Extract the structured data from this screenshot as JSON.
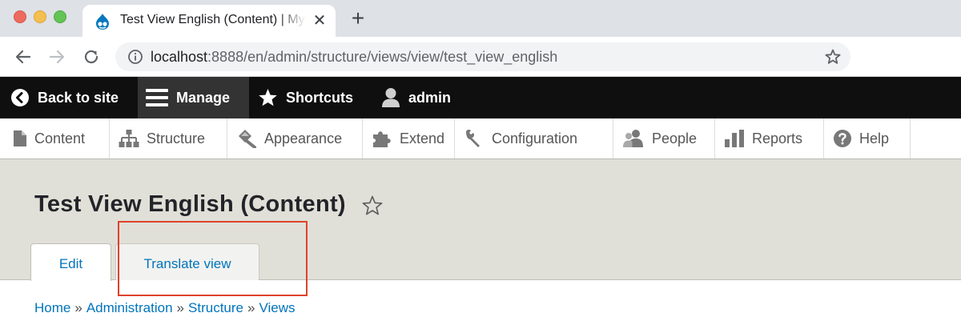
{
  "browser": {
    "tab_title": "Test View English (Content) | My Drupal Site",
    "tab_close_glyph": "✕",
    "new_tab_glyph": "+",
    "url_host": "localhost",
    "url_rest": ":8888/en/admin/structure/views/view/test_view_english"
  },
  "admin_toolbar": {
    "back_to_site": "Back to site",
    "manage": "Manage",
    "shortcuts": "Shortcuts",
    "user": "admin"
  },
  "tray": {
    "items": [
      {
        "label": "Content",
        "icon": "file-icon"
      },
      {
        "label": "Structure",
        "icon": "sitemap-icon"
      },
      {
        "label": "Appearance",
        "icon": "paint-icon"
      },
      {
        "label": "Extend",
        "icon": "puzzle-icon"
      },
      {
        "label": "Configuration",
        "icon": "wrench-icon"
      },
      {
        "label": "People",
        "icon": "people-icon"
      },
      {
        "label": "Reports",
        "icon": "bar-chart-icon"
      },
      {
        "label": "Help",
        "icon": "help-icon"
      }
    ]
  },
  "page": {
    "title": "Test View English (Content)",
    "tabs": [
      {
        "label": "Edit",
        "active": true
      },
      {
        "label": "Translate view",
        "active": false
      }
    ]
  },
  "breadcrumb": {
    "items": [
      "Home",
      "Administration",
      "Structure",
      "Views"
    ],
    "separator": "»"
  },
  "colors": {
    "link": "#0074bd",
    "admin_bar": "#0f0f0f",
    "header_bg": "#e0e0d8",
    "highlight": "#e0412c"
  }
}
